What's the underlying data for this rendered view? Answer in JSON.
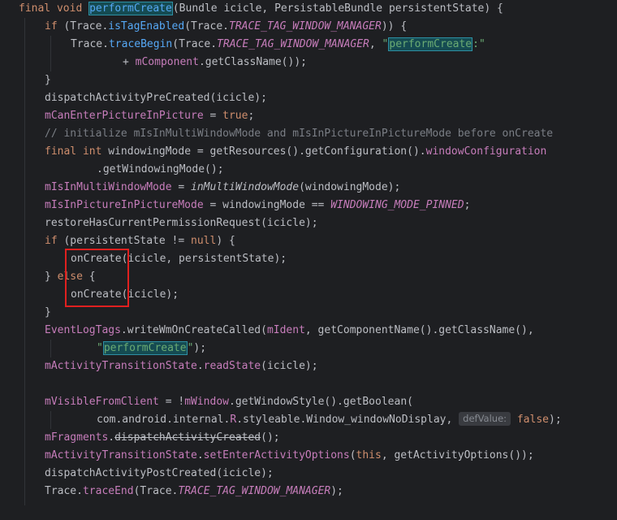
{
  "colors": {
    "background": "#1e1f22",
    "keyword": "#cf8e6d",
    "method": "#56a8f5",
    "field": "#c77dbb",
    "string": "#6aab73",
    "comment": "#7a7e85",
    "annotation_box": "#e0201f"
  },
  "code": {
    "lines": [
      [
        [
          "kw",
          "final void "
        ],
        [
          "fn-hl",
          "performCreate"
        ],
        [
          "plain",
          "(Bundle icicle, PersistableBundle persistentState) {"
        ]
      ],
      [
        [
          "kw",
          "if "
        ],
        [
          "plain",
          "(Trace."
        ],
        [
          "fn",
          "isTagEnabled"
        ],
        [
          "plain",
          "(Trace."
        ],
        [
          "sfld",
          "TRACE_TAG_WINDOW_MANAGER"
        ],
        [
          "plain",
          ")) {"
        ]
      ],
      [
        [
          "plain",
          "Trace."
        ],
        [
          "fn",
          "traceBegin"
        ],
        [
          "plain",
          "(Trace."
        ],
        [
          "sfld",
          "TRACE_TAG_WINDOW_MANAGER"
        ],
        [
          "plain",
          ", "
        ],
        [
          "str",
          "\""
        ],
        [
          "str-hl",
          "performCreate"
        ],
        [
          "str",
          ":\""
        ]
      ],
      [
        [
          "plain",
          "+ "
        ],
        [
          "fld",
          "mComponent"
        ],
        [
          "plain",
          ".getClassName());"
        ]
      ],
      [
        [
          "plain",
          "}"
        ]
      ],
      [
        [
          "plain",
          "dispatchActivityPreCreated(icicle);"
        ]
      ],
      [
        [
          "fld",
          "mCanEnterPictureInPicture"
        ],
        [
          "plain",
          " = "
        ],
        [
          "kw",
          "true"
        ],
        [
          "plain",
          ";"
        ]
      ],
      [
        [
          "cmt",
          "// initialize mIsInMultiWindowMode and mIsInPictureInPictureMode before onCreate"
        ]
      ],
      [
        [
          "kw",
          "final int "
        ],
        [
          "plain",
          "windowingMode = getResources().getConfiguration()."
        ],
        [
          "fld",
          "windowConfiguration"
        ]
      ],
      [
        [
          "plain",
          ".getWindowingMode();"
        ]
      ],
      [
        [
          "fld",
          "mIsInMultiWindowMode"
        ],
        [
          "plain",
          " = "
        ],
        [
          "ital",
          "inMultiWindowMode"
        ],
        [
          "plain",
          "(windowingMode);"
        ]
      ],
      [
        [
          "fld",
          "mIsInPictureInPictureMode"
        ],
        [
          "plain",
          " = windowingMode == "
        ],
        [
          "sfld",
          "WINDOWING_MODE_PINNED"
        ],
        [
          "plain",
          ";"
        ]
      ],
      [
        [
          "plain",
          "restoreHasCurrentPermissionRequest(icicle);"
        ]
      ],
      [
        [
          "kw",
          "if "
        ],
        [
          "plain",
          "(persistentState != "
        ],
        [
          "kw",
          "null"
        ],
        [
          "plain",
          ") {"
        ]
      ],
      [
        [
          "plain",
          "onCreate(icicle, persistentState);"
        ]
      ],
      [
        [
          "plain",
          "} "
        ],
        [
          "kw",
          "else "
        ],
        [
          "plain",
          "{"
        ]
      ],
      [
        [
          "plain",
          "onCreate(icicle);"
        ]
      ],
      [
        [
          "plain",
          "}"
        ]
      ],
      [
        [
          "fld",
          "EventLogTags"
        ],
        [
          "plain",
          ".writeWmOnCreateCalled("
        ],
        [
          "fld",
          "mIdent"
        ],
        [
          "plain",
          ", getComponentName().getClassName(),"
        ]
      ],
      [
        [
          "str",
          "\""
        ],
        [
          "str-hl",
          "performCreate"
        ],
        [
          "str",
          "\""
        ],
        [
          "plain",
          ");"
        ]
      ],
      [
        [
          "fld",
          "mActivityTransitionState"
        ],
        [
          "plain",
          "."
        ],
        [
          "fld",
          "readState"
        ],
        [
          "plain",
          "(icicle);"
        ]
      ],
      [],
      [
        [
          "fld",
          "mVisibleFromClient"
        ],
        [
          "plain",
          " = !"
        ],
        [
          "fld",
          "mWindow"
        ],
        [
          "plain",
          ".getWindowStyle().getBoolean("
        ]
      ],
      [
        [
          "plain",
          "com.android.internal."
        ],
        [
          "fld",
          "R"
        ],
        [
          "plain",
          ".styleable.Window_windowNoDisplay, "
        ],
        [
          "hint",
          "defValue:"
        ],
        [
          "kw",
          " false"
        ],
        [
          "plain",
          ");"
        ]
      ],
      [
        [
          "fld",
          "mFragments"
        ],
        [
          "plain",
          "."
        ],
        [
          "strike",
          "dispatchActivityCreated"
        ],
        [
          "plain",
          "();"
        ]
      ],
      [
        [
          "fld",
          "mActivityTransitionState"
        ],
        [
          "plain",
          "."
        ],
        [
          "fld",
          "setEnterActivityOptions"
        ],
        [
          "plain",
          "("
        ],
        [
          "kw",
          "this"
        ],
        [
          "plain",
          ", getActivityOptions());"
        ]
      ],
      [
        [
          "plain",
          "dispatchActivityPostCreated(icicle);"
        ]
      ],
      [
        [
          "plain",
          "Trace."
        ],
        [
          "fld",
          "traceEnd"
        ],
        [
          "plain",
          "(Trace."
        ],
        [
          "sfld",
          "TRACE_TAG_WINDOW_MANAGER"
        ],
        [
          "plain",
          ");"
        ]
      ],
      [],
      [
        [
          "plain",
          "}"
        ]
      ]
    ]
  }
}
